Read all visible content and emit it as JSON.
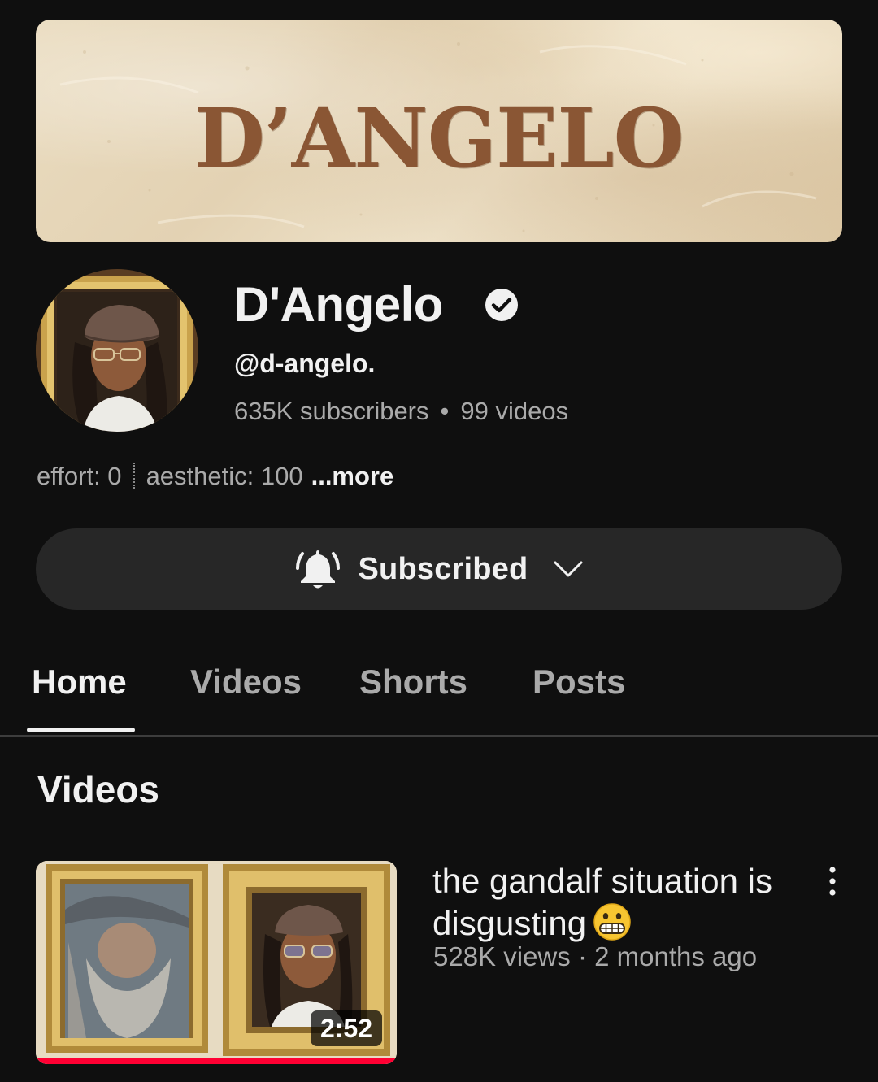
{
  "banner": {
    "title": "D’ANGELO"
  },
  "channel": {
    "name": "D'Angelo",
    "verified": true,
    "handle": "@d-angelo.",
    "subscribers": "635K subscribers",
    "separator": "•",
    "video_count": "99 videos",
    "description_part1": "effort: 0",
    "description_part2": "aesthetic: 100",
    "more_label": "...more"
  },
  "subscribe_button": {
    "label": "Subscribed",
    "icon": "bell-ringing-icon",
    "dropdown_icon": "chevron-down-icon"
  },
  "tabs": [
    {
      "label": "Home",
      "active": true
    },
    {
      "label": "Videos",
      "active": false
    },
    {
      "label": "Shorts",
      "active": false
    },
    {
      "label": "Posts",
      "active": false
    }
  ],
  "section": {
    "title": "Videos"
  },
  "videos": [
    {
      "title": "the gandalf situation is disgusting",
      "title_emoji": "grimacing-face-emoji",
      "views": "528K views",
      "meta_separator": "·",
      "age": "2 months ago",
      "duration": "2:52",
      "watch_progress": 1.0,
      "menu_icon": "more-vertical-icon"
    }
  ],
  "colors": {
    "background": "#0f0f0f",
    "banner_text": "#8a5634",
    "button_bg": "#272727",
    "progress": "#ff0033",
    "muted_text": "#aaaaaa"
  }
}
